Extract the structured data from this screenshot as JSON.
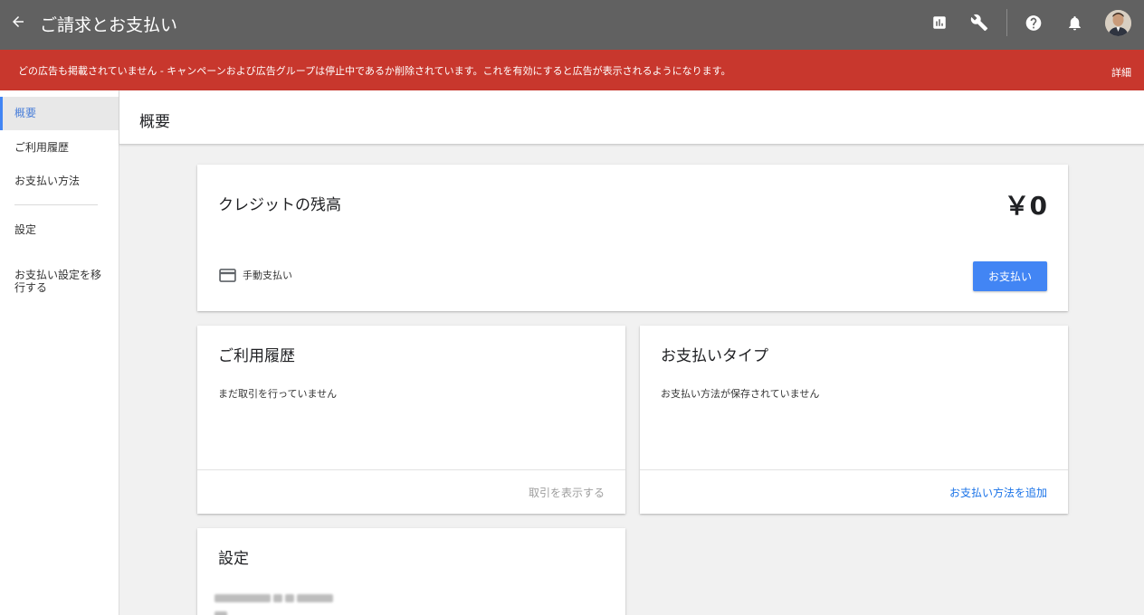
{
  "topbar": {
    "title": "ご請求とお支払い",
    "icons": [
      "back-arrow-icon",
      "reports-icon",
      "tools-icon",
      "help-icon",
      "notifications-icon"
    ]
  },
  "alert": {
    "message": "どの広告も掲載されていません - キャンペーンおよび広告グループは停止中であるか削除されています。これを有効にすると広告が表示されるようになります。",
    "link": "詳細"
  },
  "sidebar": {
    "items": [
      {
        "label": "概要"
      },
      {
        "label": "ご利用履歴"
      },
      {
        "label": "お支払い方法"
      },
      {
        "label": "設定"
      },
      {
        "label": "お支払い設定を移\n行する"
      }
    ]
  },
  "page": {
    "title": "概要"
  },
  "credit_card": {
    "title": "クレジットの残高",
    "amount": "￥0",
    "method_icon": "credit-card-icon",
    "method_label": "手動支払い",
    "button": "お支払い"
  },
  "history_card": {
    "title": "ご利用履歴",
    "body": "まだ取引を行っていません",
    "link": "取引を表示する"
  },
  "payment_type_card": {
    "title": "お支払いタイプ",
    "body": "お支払い方法が保存されていません",
    "link": "お支払い方法を追加"
  },
  "settings_card": {
    "title": "設定"
  },
  "colors": {
    "topbar": "#616161",
    "alert": "#c8372d",
    "primary": "#4285f4",
    "link_active": "#1a73e8",
    "link_disabled": "#9e9e9e"
  }
}
